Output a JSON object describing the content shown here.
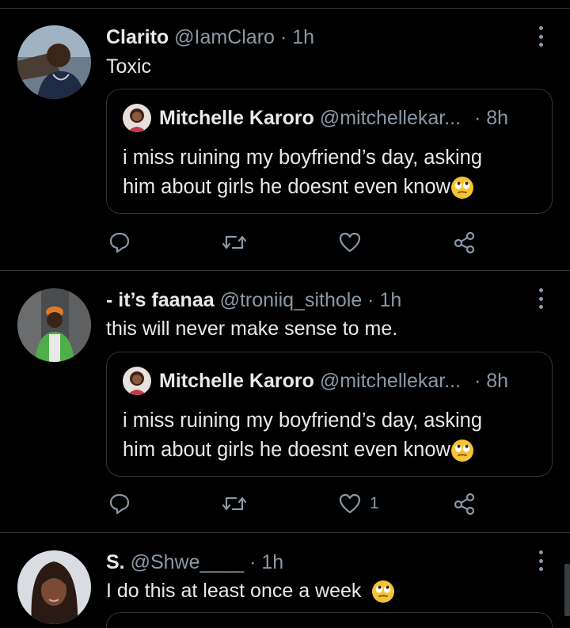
{
  "tweets": [
    {
      "name": "Clarito",
      "handle": "@IamClaro",
      "dot": "·",
      "time": "1h",
      "text": "Toxic",
      "quote": {
        "name": "Mitchelle Karoro",
        "handle": "@mitchellekar...",
        "dot": "·",
        "time": "8h",
        "line1": "i miss ruining my boyfriend’s day, asking",
        "line2": "him about girls he doesnt even know"
      },
      "likes": ""
    },
    {
      "name": "- it’s faanaa",
      "handle": "@troniiq_sithole",
      "dot": "·",
      "time": "1h",
      "text": "this will never make sense to me.",
      "quote": {
        "name": "Mitchelle Karoro",
        "handle": "@mitchellekar...",
        "dot": "·",
        "time": "8h",
        "line1": "i miss ruining my boyfriend’s day, asking",
        "line2": "him about girls he doesnt even know"
      },
      "likes": "1"
    },
    {
      "name": "S.",
      "handle": "@Shwe____",
      "dot": "·",
      "time": "1h",
      "text": "I do this at least once a week"
    }
  ],
  "icons": {
    "reply": "reply-icon",
    "retweet": "retweet-icon",
    "like": "heart-icon",
    "share": "share-icon",
    "more": "more-icon",
    "emoji": "eye-roll-emoji-icon"
  },
  "colors": {
    "background": "#000000",
    "text": "#e7e9ea",
    "secondary": "#8b98a5",
    "border": "#2f3336",
    "emoji": "#f5c433"
  }
}
